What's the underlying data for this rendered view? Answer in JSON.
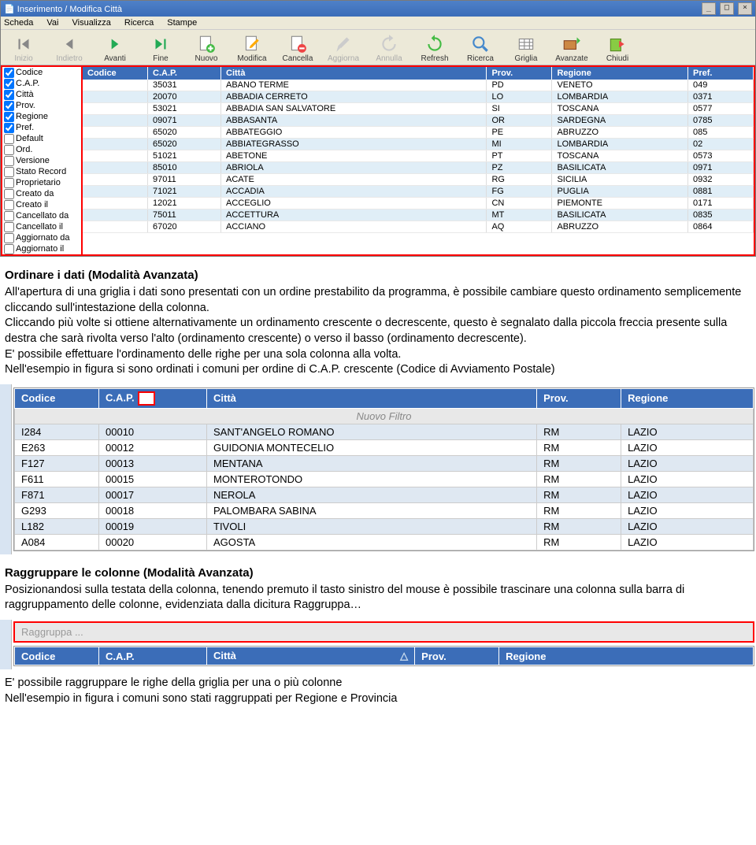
{
  "window": {
    "title": "Inserimento / Modifica Città"
  },
  "menu": [
    "Scheda",
    "Vai",
    "Visualizza",
    "Ricerca",
    "Stampe"
  ],
  "toolbar": [
    {
      "label": "Inizio",
      "dis": true
    },
    {
      "label": "Indietro",
      "dis": true
    },
    {
      "label": "Avanti"
    },
    {
      "label": "Fine"
    },
    {
      "label": "Nuovo"
    },
    {
      "label": "Modifica"
    },
    {
      "label": "Cancella"
    },
    {
      "label": "Aggiorna",
      "dis": true
    },
    {
      "label": "Annulla",
      "dis": true
    },
    {
      "label": "Refresh"
    },
    {
      "label": "Ricerca"
    },
    {
      "label": "Griglia"
    },
    {
      "label": "Avanzate"
    },
    {
      "label": "Chiudi"
    }
  ],
  "checklist": [
    {
      "l": "Codice",
      "c": true
    },
    {
      "l": "C.A.P.",
      "c": true
    },
    {
      "l": "Città",
      "c": true
    },
    {
      "l": "Prov.",
      "c": true
    },
    {
      "l": "Regione",
      "c": true
    },
    {
      "l": "Pref.",
      "c": true
    },
    {
      "l": "Default",
      "c": false
    },
    {
      "l": "Ord.",
      "c": false
    },
    {
      "l": "Versione",
      "c": false
    },
    {
      "l": "Stato Record",
      "c": false
    },
    {
      "l": "Proprietario",
      "c": false
    },
    {
      "l": "Creato da",
      "c": false
    },
    {
      "l": "Creato il",
      "c": false
    },
    {
      "l": "Cancellato da",
      "c": false
    },
    {
      "l": "Cancellato il",
      "c": false
    },
    {
      "l": "Aggiornato da",
      "c": false
    },
    {
      "l": "Aggiornato il",
      "c": false
    }
  ],
  "grid1": {
    "headers": [
      "Codice",
      "C.A.P.",
      "Città",
      "Prov.",
      "Regione",
      "Pref."
    ],
    "rows": [
      [
        "",
        "35031",
        "ABANO TERME",
        "PD",
        "VENETO",
        "049"
      ],
      [
        "",
        "20070",
        "ABBADIA CERRETO",
        "LO",
        "LOMBARDIA",
        "0371"
      ],
      [
        "",
        "53021",
        "ABBADIA SAN SALVATORE",
        "SI",
        "TOSCANA",
        "0577"
      ],
      [
        "",
        "09071",
        "ABBASANTA",
        "OR",
        "SARDEGNA",
        "0785"
      ],
      [
        "",
        "65020",
        "ABBATEGGIO",
        "PE",
        "ABRUZZO",
        "085"
      ],
      [
        "",
        "65020",
        "ABBIATEGRASSO",
        "MI",
        "LOMBARDIA",
        "02"
      ],
      [
        "",
        "51021",
        "ABETONE",
        "PT",
        "TOSCANA",
        "0573"
      ],
      [
        "",
        "85010",
        "ABRIOLA",
        "PZ",
        "BASILICATA",
        "0971"
      ],
      [
        "",
        "97011",
        "ACATE",
        "RG",
        "SICILIA",
        "0932"
      ],
      [
        "",
        "71021",
        "ACCADIA",
        "FG",
        "PUGLIA",
        "0881"
      ],
      [
        "",
        "12021",
        "ACCEGLIO",
        "CN",
        "PIEMONTE",
        "0171"
      ],
      [
        "",
        "75011",
        "ACCETTURA",
        "MT",
        "BASILICATA",
        "0835"
      ],
      [
        "",
        "67020",
        "ACCIANO",
        "AQ",
        "ABRUZZO",
        "0864"
      ]
    ]
  },
  "text1": {
    "h": "Ordinare i dati (Modalità Avanzata)",
    "p1": "All'apertura di una griglia i dati sono presentati con un ordine prestabilito da programma, è possibile cambiare questo ordinamento semplicemente cliccando sull'intestazione della colonna.",
    "p2": "Cliccando più volte si ottiene alternativamente un ordinamento crescente o decrescente, questo è segnalato dalla piccola freccia presente sulla destra che sarà rivolta verso l'alto (ordinamento crescente) o verso il basso (ordinamento decrescente).",
    "p3": "E' possibile effettuare l'ordinamento delle righe per una sola colonna alla volta.",
    "p4": "Nell'esempio in figura si sono ordinati i comuni per ordine di C.A.P. crescente (Codice di Avviamento Postale)"
  },
  "grid2": {
    "headers": [
      "Codice",
      "C.A.P.",
      "Città",
      "Prov.",
      "Regione"
    ],
    "filter": "Nuovo Filtro",
    "rows": [
      [
        "I284",
        "00010",
        "SANT'ANGELO ROMANO",
        "RM",
        "LAZIO"
      ],
      [
        "E263",
        "00012",
        "GUIDONIA MONTECELIO",
        "RM",
        "LAZIO"
      ],
      [
        "F127",
        "00013",
        "MENTANA",
        "RM",
        "LAZIO"
      ],
      [
        "F611",
        "00015",
        "MONTEROTONDO",
        "RM",
        "LAZIO"
      ],
      [
        "F871",
        "00017",
        "NEROLA",
        "RM",
        "LAZIO"
      ],
      [
        "G293",
        "00018",
        "PALOMBARA SABINA",
        "RM",
        "LAZIO"
      ],
      [
        "L182",
        "00019",
        "TIVOLI",
        "RM",
        "LAZIO"
      ],
      [
        "A084",
        "00020",
        "AGOSTA",
        "RM",
        "LAZIO"
      ]
    ]
  },
  "text2": {
    "h": "Raggruppare le colonne (Modalità Avanzata)",
    "p1": "Posizionandosi sulla testata della colonna, tenendo premuto il tasto sinistro del mouse è possibile trascinare una colonna sulla barra di raggruppamento delle colonne, evidenziata dalla dicitura Raggruppa…"
  },
  "ragg": "Raggruppa ...",
  "grid3": {
    "headers": [
      "Codice",
      "C.A.P.",
      "Città",
      "Prov.",
      "Regione"
    ]
  },
  "text3": {
    "p1": "E' possibile raggruppare le righe della griglia per una o più colonne",
    "p2": "Nell'esempio in figura i comuni sono stati raggruppati per Regione e Provincia"
  }
}
